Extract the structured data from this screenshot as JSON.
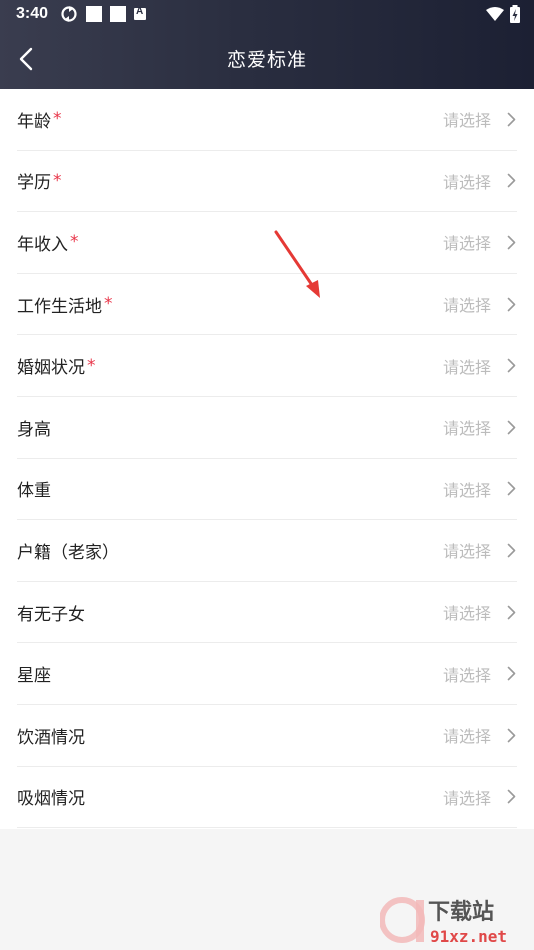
{
  "status_bar": {
    "time": "3:40"
  },
  "header": {
    "title": "恋爱标准"
  },
  "list": {
    "placeholder": "请选择",
    "items": [
      {
        "label": "年龄",
        "required": "*"
      },
      {
        "label": "学历",
        "required": "*"
      },
      {
        "label": "年收入",
        "required": "*"
      },
      {
        "label": "工作生活地",
        "required": "*"
      },
      {
        "label": "婚姻状况",
        "required": "*"
      },
      {
        "label": "身高",
        "required": ""
      },
      {
        "label": "体重",
        "required": ""
      },
      {
        "label": "户籍（老家）",
        "required": ""
      },
      {
        "label": "有无子女",
        "required": ""
      },
      {
        "label": "星座",
        "required": ""
      },
      {
        "label": "饮酒情况",
        "required": ""
      },
      {
        "label": "吸烟情况",
        "required": ""
      }
    ]
  },
  "watermark": {
    "text": "91xz.net",
    "cn": "下载站"
  },
  "colors": {
    "accent_star": "#e8364a",
    "header_dark": "#1c2033",
    "placeholder": "#bcbcbc",
    "annotation_arrow": "#e53935"
  }
}
